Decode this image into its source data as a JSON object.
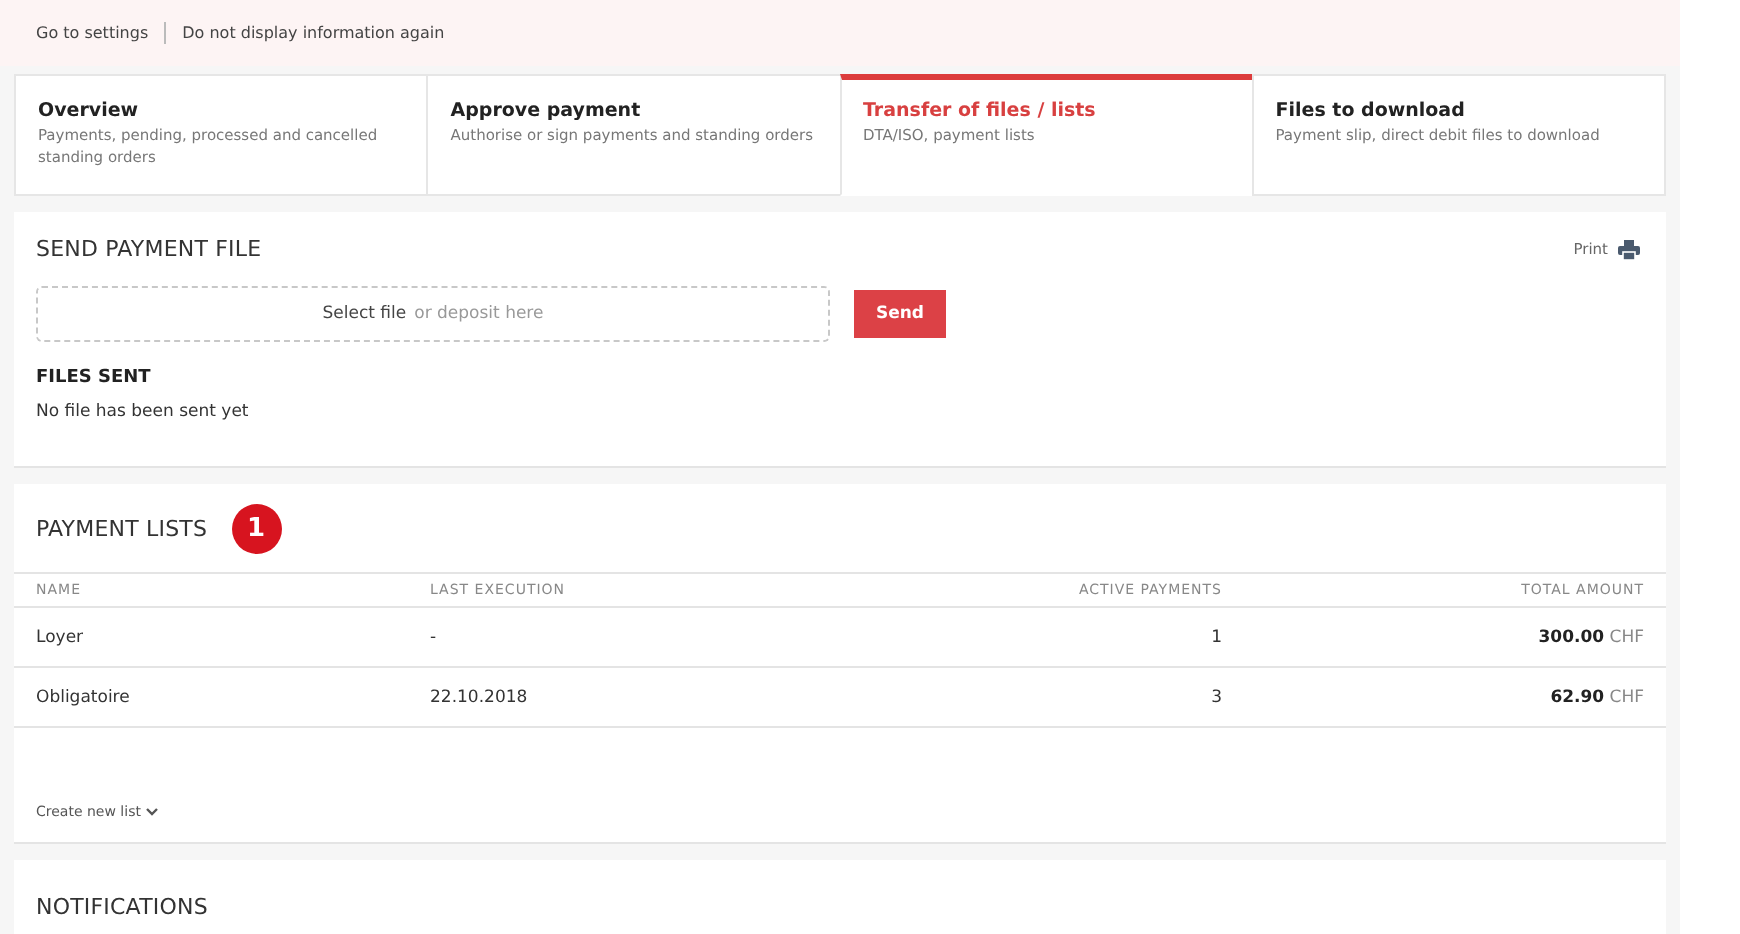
{
  "banner": {
    "links": [
      "Go to settings",
      "Do not display information again"
    ]
  },
  "tabs": [
    {
      "title": "Overview",
      "subtitle": "Payments, pending, processed and cancelled standing orders",
      "selected": false
    },
    {
      "title": "Approve payment",
      "subtitle": "Authorise or sign payments and standing orders",
      "selected": false
    },
    {
      "title": "Transfer of files / lists",
      "subtitle": "DTA/ISO, payment lists",
      "selected": true
    },
    {
      "title": "Files to download",
      "subtitle": "Payment slip, direct debit files to download",
      "selected": false
    }
  ],
  "send_payment_file": {
    "title": "SEND PAYMENT FILE",
    "print": "Print",
    "dropzone": {
      "action": "Select file",
      "hint": "or deposit here"
    },
    "send_button": "Send",
    "files_sent_title": "FILES SENT",
    "files_sent_empty": "No file has been sent yet"
  },
  "payment_lists": {
    "title": "PAYMENT LISTS",
    "badge": "1",
    "columns": [
      "NAME",
      "LAST EXECUTION",
      "ACTIVE PAYMENTS",
      "TOTAL AMOUNT"
    ],
    "rows": [
      {
        "name": "Loyer",
        "last_execution": "-",
        "active_payments": "1",
        "total_amount": "**300.00** CHF"
      },
      {
        "name": "Obligatoire",
        "last_execution": "22.10.2018",
        "active_payments": "3",
        "total_amount": "**62.90** CHF"
      }
    ],
    "create_link": "Create new list"
  },
  "notifications": {
    "title": "NOTIFICATIONS"
  }
}
